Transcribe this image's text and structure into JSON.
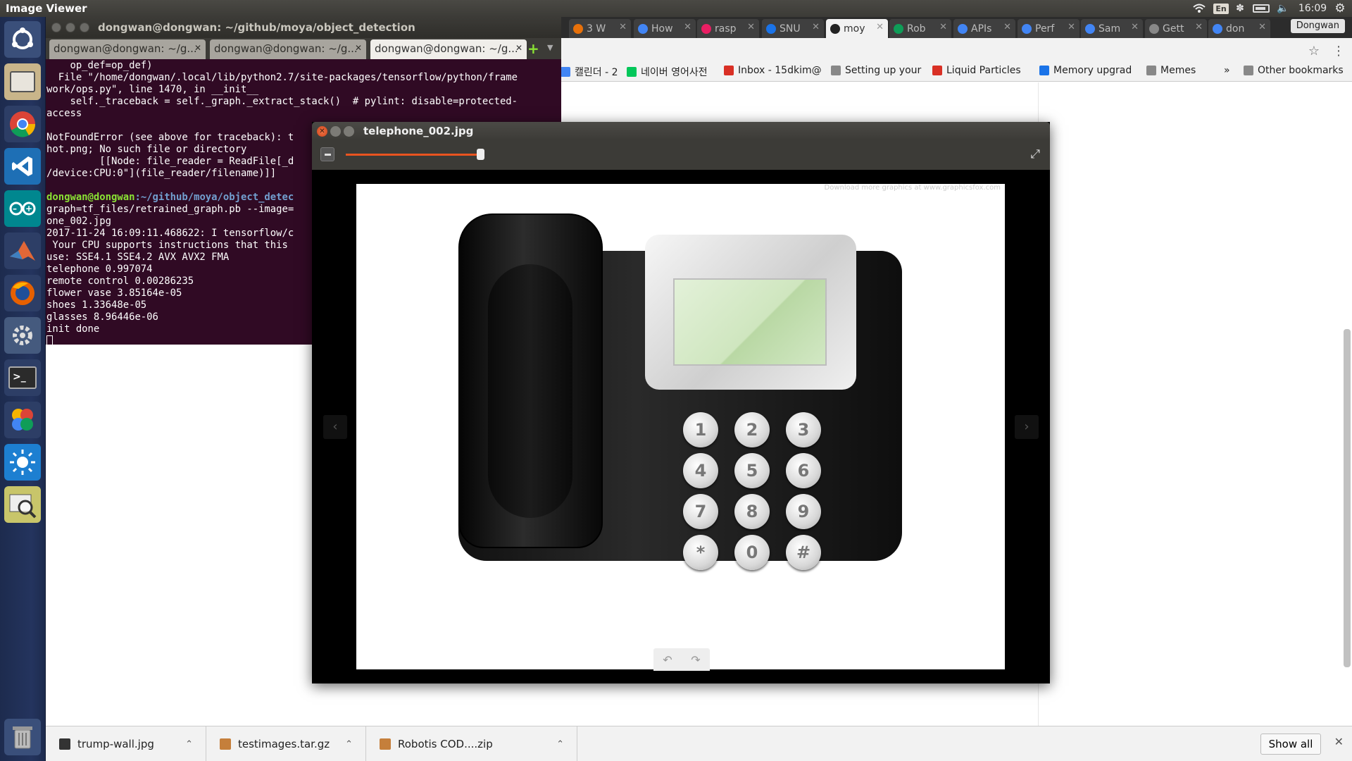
{
  "top_panel": {
    "app_title": "Image Viewer",
    "kbd_layout": "En",
    "time": "16:09"
  },
  "terminal": {
    "title": "dongwan@dongwan: ~/github/moya/object_detection",
    "tabs": [
      "dongwan@dongwan: ~/g...",
      "dongwan@dongwan: ~/g...",
      "dongwan@dongwan: ~/g..."
    ],
    "lines": [
      "    op_def=op_def)",
      "  File \"/home/dongwan/.local/lib/python2.7/site-packages/tensorflow/python/frame",
      "work/ops.py\", line 1470, in __init__",
      "    self._traceback = self._graph._extract_stack()  # pylint: disable=protected-",
      "access",
      "",
      "NotFoundError (see above for traceback): t",
      "hot.png; No such file or directory",
      "         [[Node: file_reader = ReadFile[_d",
      "/device:CPU:0\"](file_reader/filename)]]",
      "",
      "__PROMPT__",
      "graph=tf_files/retrained_graph.pb --image=",
      "one_002.jpg",
      "2017-11-24 16:09:11.468622: I tensorflow/c",
      " Your CPU supports instructions that this",
      "use: SSE4.1 SSE4.2 AVX AVX2 FMA",
      "telephone 0.997074",
      "remote control 0.00286235",
      "flower vase 3.85164e-05",
      "shoes 1.33648e-05",
      "glasses 8.96446e-06",
      "init done"
    ],
    "prompt_user": "dongwan@dongwan",
    "prompt_path": ":~/github/moya/object_detec"
  },
  "browser": {
    "tabs": [
      "3 W",
      "How",
      "rasp",
      "SNU",
      "moy",
      "Rob",
      "APIs",
      "Perf",
      "Sam",
      "Gett",
      "don"
    ],
    "profile": "Dongwan",
    "bookmarks": [
      "캘린더 - 2",
      "네이버 영어사전",
      "Inbox - 15dkim@",
      "Setting up your",
      "Liquid Particles",
      "Memory upgrad",
      "Memes",
      "»",
      "Other bookmarks"
    ]
  },
  "image_viewer": {
    "title": "telephone_002.jpg",
    "zoom_fraction": 0.98,
    "watermark": "Download more graphics at www.graphicsfox.com",
    "keypad": [
      "1",
      "2",
      "3",
      "4",
      "5",
      "6",
      "7",
      "8",
      "9",
      "*",
      "0",
      "#"
    ]
  },
  "downloads": {
    "items": [
      "trump-wall.jpg",
      "testimages.tar.gz",
      "Robotis COD....zip"
    ],
    "show_all": "Show all"
  },
  "colors": {
    "terminal_bg": "#300a24",
    "accent": "#e95420",
    "launcher_bg": "#24345e"
  }
}
